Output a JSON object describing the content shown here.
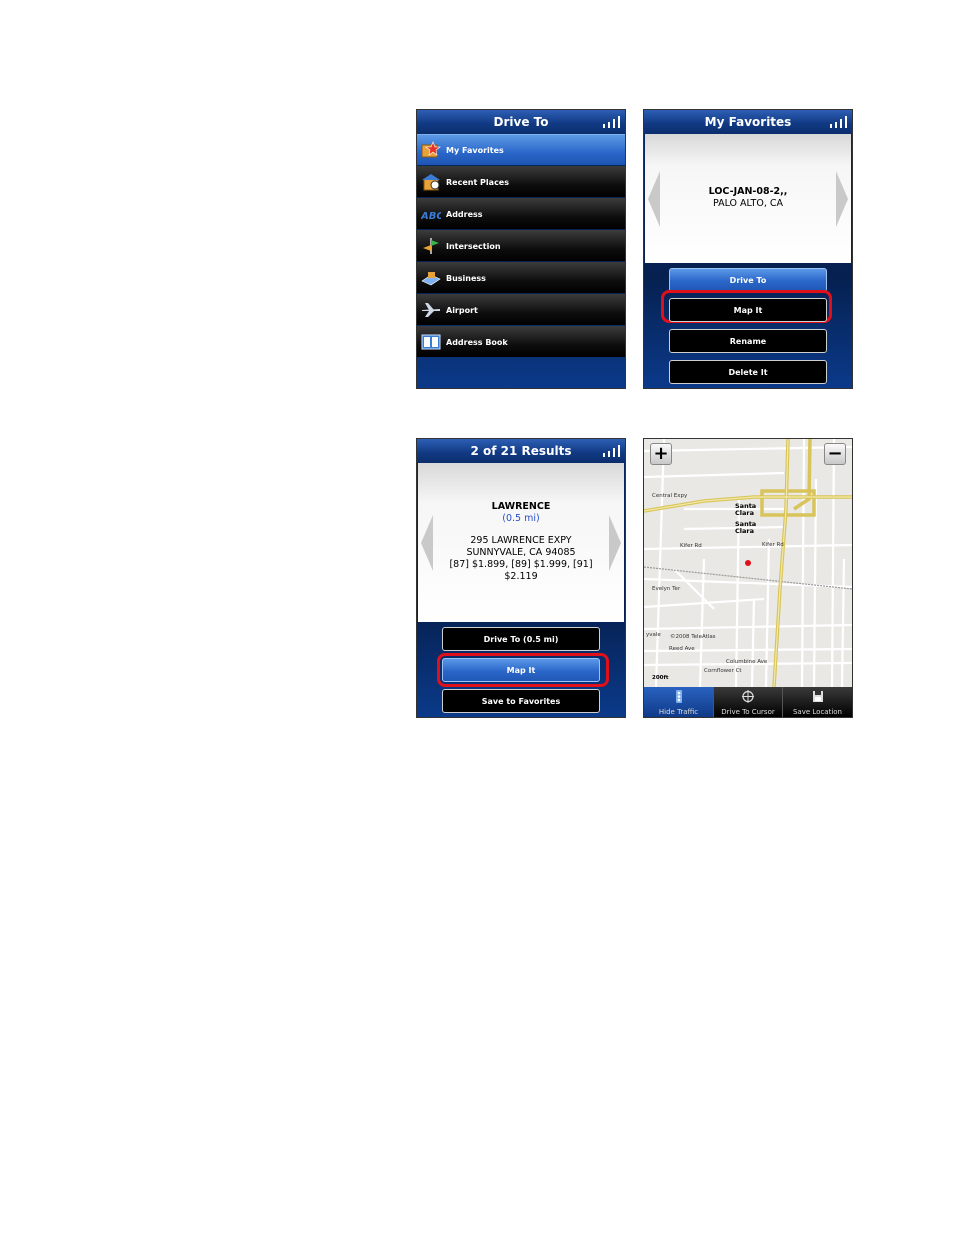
{
  "drive_to": {
    "title": "Drive To",
    "items": [
      {
        "label": "My Favorites",
        "icon": "favorites-icon",
        "selected": true
      },
      {
        "label": "Recent Places",
        "icon": "recent-places-icon"
      },
      {
        "label": "Address",
        "icon": "address-icon"
      },
      {
        "label": "Intersection",
        "icon": "intersection-icon"
      },
      {
        "label": "Business",
        "icon": "business-icon"
      },
      {
        "label": "Airport",
        "icon": "airport-icon"
      },
      {
        "label": "Address Book",
        "icon": "address-book-icon"
      }
    ]
  },
  "favorites": {
    "title": "My Favorites",
    "name": "LOC-JAN-08-2,,",
    "city": "PALO ALTO, CA",
    "buttons": [
      "Drive To",
      "Map It",
      "Rename",
      "Delete It"
    ]
  },
  "results": {
    "title": "2 of 21 Results",
    "name": "LAWRENCE",
    "distance": "(0.5 mi)",
    "address1": "295 LAWRENCE EXPY",
    "address2": "SUNNYVALE, CA 94085",
    "prices1": "[87] $1.899, [89] $1.999, [91]",
    "prices2": "$2.119",
    "buttons": [
      "Drive To (0.5 mi)",
      "Map It",
      "Save to Favorites"
    ]
  },
  "map": {
    "zoom_in": "+",
    "zoom_out": "−",
    "labels": {
      "central_expy": "Central Expy",
      "santa_clara_1": "Santa Clara",
      "santa_clara_2": "Santa Clara",
      "kifer_rd": "Kifer Rd",
      "kifer_rd_2": "Kifer Rd",
      "reed_ave": "Reed Ave",
      "columbine_ave": "Columbine Ave",
      "cornflower_ct": "Cornflower Ct",
      "evelyn_ter": "Evelyn Ter",
      "copyright": "©2008 TeleAtlas",
      "scale": "200ft",
      "yvale": "yvale"
    },
    "tabs": [
      "Hide Traffic",
      "Drive To Cursor",
      "Save Location"
    ]
  }
}
